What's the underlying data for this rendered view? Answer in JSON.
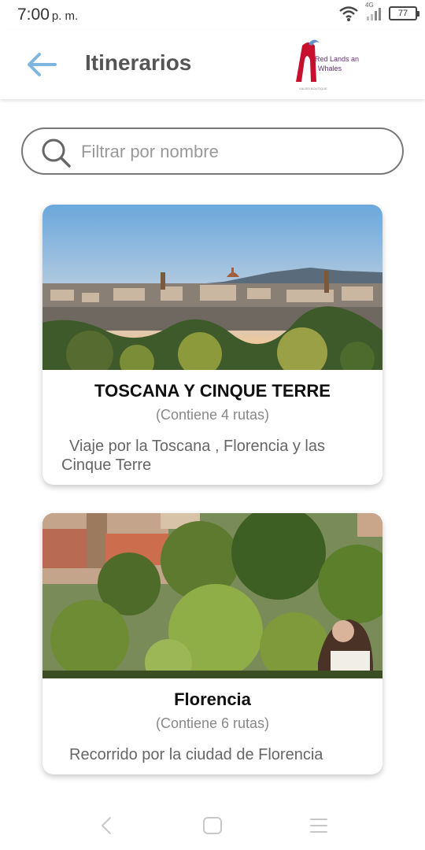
{
  "status_bar": {
    "time": "7:00",
    "ampm": "p. m.",
    "network_label": "4G",
    "battery": "77",
    "icons": [
      "wifi-icon",
      "signal-icon",
      "battery-icon"
    ]
  },
  "header": {
    "title": "Itinerarios",
    "back_icon": "arrow-left-icon",
    "logo_text_line1": "Red Lands and",
    "logo_text_line2": "Whales",
    "logo_tagline": "VIAJES BOUTIQUE"
  },
  "search": {
    "placeholder": "Filtrar por nombre",
    "value": "",
    "icon": "search-icon"
  },
  "itineraries": [
    {
      "title": "TOSCANA Y CINQUE TERRE",
      "routes": "(Contiene 4 rutas)",
      "description": "Viaje por la Toscana , Florencia y las Cinque Terre"
    },
    {
      "title": "Florencia",
      "routes": "(Contiene 6 rutas)",
      "description": "Recorrido por la ciudad de Florencia"
    }
  ],
  "nav_bar": {
    "icons": [
      "back-nav-icon",
      "home-nav-icon",
      "menu-nav-icon"
    ]
  },
  "colors": {
    "accent": "#7fb6e0",
    "title_text": "#555555",
    "search_border": "#777777",
    "logo_red": "#c8102e"
  }
}
